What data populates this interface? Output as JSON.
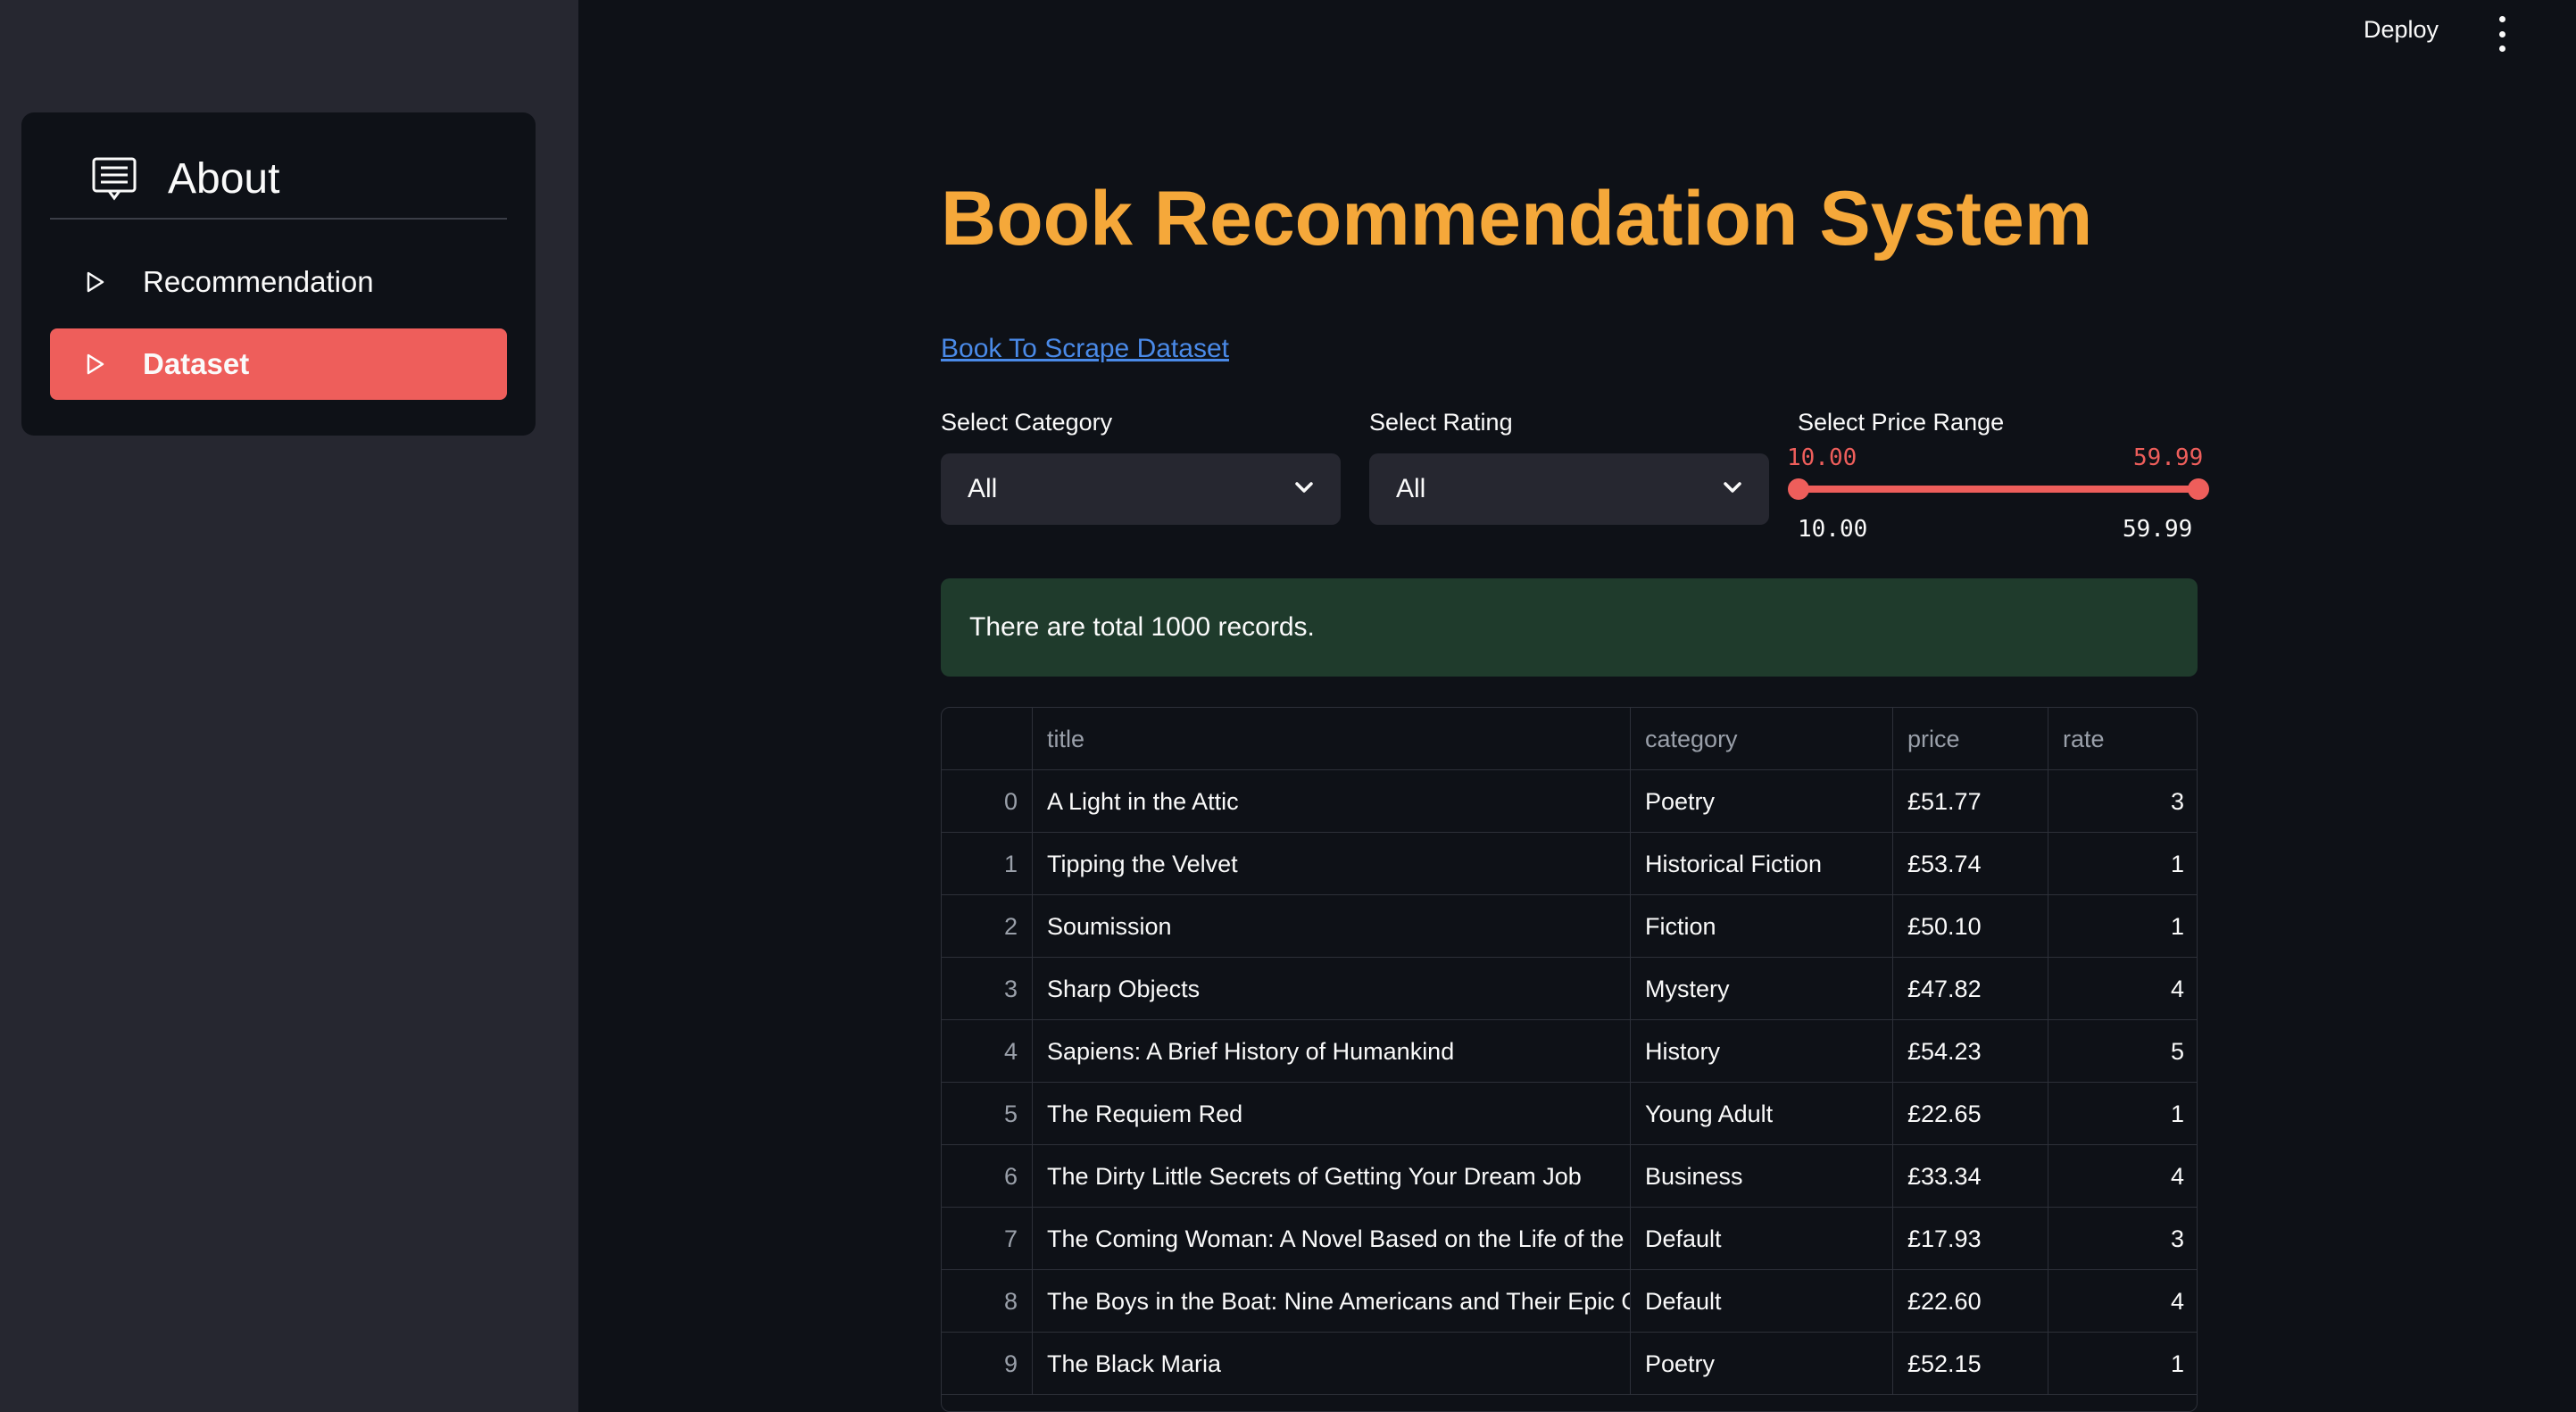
{
  "sidebar": {
    "header_label": "About",
    "items": [
      {
        "label": "Recommendation",
        "active": false
      },
      {
        "label": "Dataset",
        "active": true
      }
    ]
  },
  "toolbar": {
    "deploy_label": "Deploy"
  },
  "main": {
    "title": "Book Recommendation System",
    "dataset_link": "Book To Scrape Dataset",
    "filters": {
      "category_label": "Select Category",
      "category_value": "All",
      "rating_label": "Select Rating",
      "rating_value": "All",
      "price_label": "Select Price Range",
      "price_low": "10.00",
      "price_high": "59.99",
      "price_min": "10.00",
      "price_max": "59.99"
    },
    "alert": "There are total 1000 records.",
    "table": {
      "columns": [
        "title",
        "category",
        "price",
        "rate"
      ],
      "rows": [
        {
          "index": "0",
          "title": "A Light in the Attic",
          "category": "Poetry",
          "price": "£51.77",
          "rate": "3"
        },
        {
          "index": "1",
          "title": "Tipping the Velvet",
          "category": "Historical Fiction",
          "price": "£53.74",
          "rate": "1"
        },
        {
          "index": "2",
          "title": "Soumission",
          "category": "Fiction",
          "price": "£50.10",
          "rate": "1"
        },
        {
          "index": "3",
          "title": "Sharp Objects",
          "category": "Mystery",
          "price": "£47.82",
          "rate": "4"
        },
        {
          "index": "4",
          "title": "Sapiens: A Brief History of Humankind",
          "category": "History",
          "price": "£54.23",
          "rate": "5"
        },
        {
          "index": "5",
          "title": "The Requiem Red",
          "category": "Young Adult",
          "price": "£22.65",
          "rate": "1"
        },
        {
          "index": "6",
          "title": "The Dirty Little Secrets of Getting Your Dream Job",
          "category": "Business",
          "price": "£33.34",
          "rate": "4"
        },
        {
          "index": "7",
          "title": "The Coming Woman: A Novel Based on the Life of the Inf",
          "category": "Default",
          "price": "£17.93",
          "rate": "3"
        },
        {
          "index": "8",
          "title": "The Boys in the Boat: Nine Americans and Their Epic Que",
          "category": "Default",
          "price": "£22.60",
          "rate": "4"
        },
        {
          "index": "9",
          "title": "The Black Maria",
          "category": "Poetry",
          "price": "£52.15",
          "rate": "1"
        }
      ]
    }
  },
  "colors": {
    "accent": "#ee5e5b",
    "title": "#f5a83a",
    "link": "#4a8ae8",
    "success_bg": "#1f3b2c"
  },
  "icons": {
    "header": "document-list-icon",
    "nav_item": "play-triangle-icon",
    "select": "chevron-down-icon",
    "menu": "kebab-menu-icon"
  }
}
